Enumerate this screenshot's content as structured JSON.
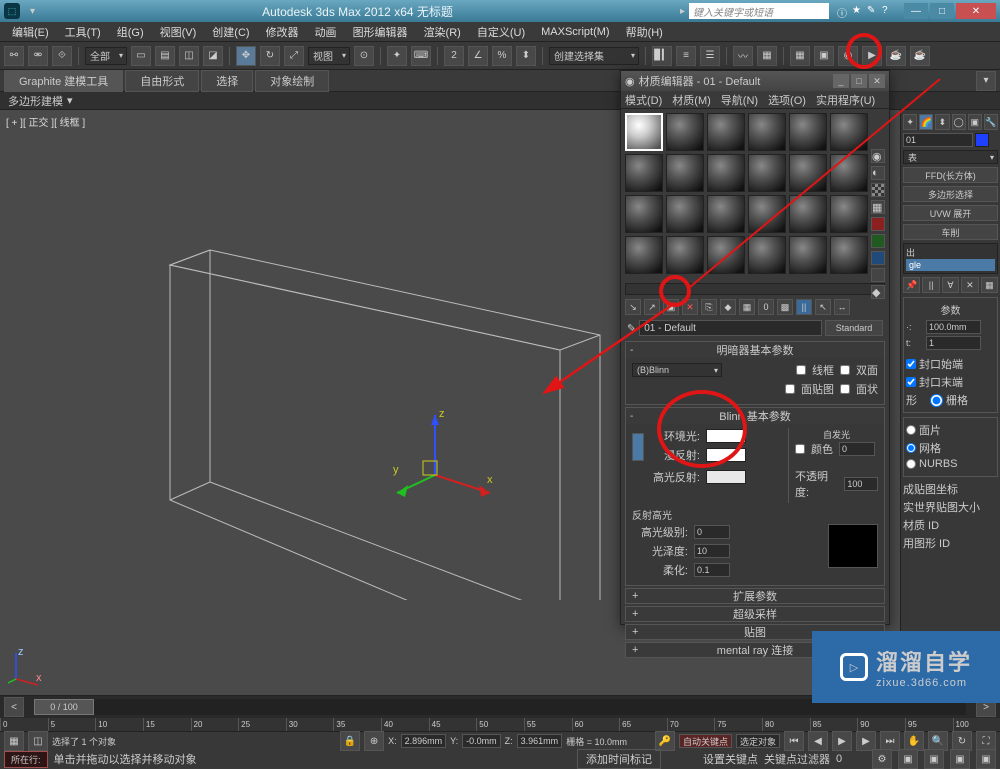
{
  "app": {
    "title": "Autodesk 3ds Max 2012 x64   无标题",
    "search_placeholder": "键入关键字或短语"
  },
  "menu": [
    "编辑(E)",
    "工具(T)",
    "组(G)",
    "视图(V)",
    "创建(C)",
    "修改器",
    "动画",
    "图形编辑器",
    "渲染(R)",
    "自定义(U)",
    "MAXScript(M)",
    "帮助(H)"
  ],
  "toolbar": {
    "scope": "全部",
    "view": "视图",
    "selset": "创建选择集"
  },
  "ribbon": {
    "tabs": [
      "Graphite 建模工具",
      "自由形式",
      "选择",
      "对象绘制"
    ],
    "sub": "多边形建模"
  },
  "viewport": {
    "label": "[ + ][ 正交 ][ 线框 ]"
  },
  "timeline": {
    "pos": "0 / 100",
    "ticks": [
      "0",
      "5",
      "10",
      "15",
      "20",
      "25",
      "30",
      "35",
      "40",
      "45",
      "50",
      "55",
      "60",
      "65",
      "70",
      "75",
      "80",
      "85",
      "90",
      "95",
      "100"
    ]
  },
  "status": {
    "sel": "选择了 1 个对象",
    "x": "2.896mm",
    "y": "-0.0mm",
    "z": "3.961mm",
    "grid": "栅格 = 10.0mm",
    "auto": "自动关键点",
    "selset2": "选定对象",
    "coord": "所在行:",
    "hint": "单击并拖动以选择并移动对象",
    "addtime": "添加时间标记",
    "setkey": "设置关键点",
    "keyfilter": "关键点过滤器"
  },
  "mateditor": {
    "title": "材质编辑器 - 01 - Default",
    "menu": [
      "模式(D)",
      "材质(M)",
      "导航(N)",
      "选项(O)",
      "实用程序(U)"
    ],
    "matname": "01 - Default",
    "mattype": "Standard",
    "roll1": "明暗器基本参数",
    "shader": "(B)Blinn",
    "opts": {
      "wire": "线框",
      "twoside": "双面",
      "facemap": "面贴图",
      "faceted": "面状"
    },
    "roll2": "Blinn 基本参数",
    "labels": {
      "ambient": "环境光:",
      "diffuse": "漫反射:",
      "specular": "高光反射:",
      "selfillum": "自发光",
      "color": "颜色",
      "opacity": "不透明度:",
      "spechigh": "反射高光",
      "speclevel": "高光级别:",
      "gloss": "光泽度:",
      "soften": "柔化:"
    },
    "vals": {
      "selfcolor": "0",
      "opacity": "100",
      "speclevel": "0",
      "gloss": "10",
      "soften": "0.1"
    },
    "collapsed": [
      "扩展参数",
      "超级采样",
      "贴图",
      "mental ray 连接"
    ]
  },
  "right": {
    "o1": "01",
    "buttons": [
      "FFD(长方体)",
      "多边形选择",
      "UVW 展开",
      "车削"
    ],
    "list": [
      "gle"
    ],
    "grp_param": "参数",
    "radius": "100.0mm",
    "seg": "1",
    "cap1": "封口始端",
    "cap2": "封口末端",
    "morph": "形",
    "grid": "栅格",
    "out_label": "输出",
    "outs": [
      "面片",
      "网格",
      "NURBS"
    ],
    "gencoord": "成贴图坐标",
    "realworld": "实世界贴图大小",
    "matid": "材质 ID",
    "smgrp": "用图形 ID"
  },
  "wm": {
    "big": "溜溜自学",
    "small": "zixue.3d66.com"
  }
}
